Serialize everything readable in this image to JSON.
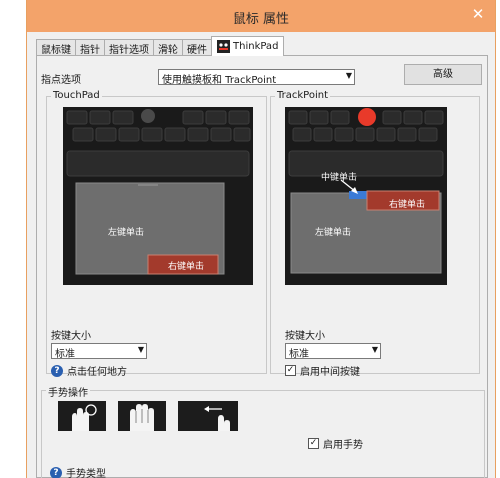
{
  "window": {
    "title": "鼠标 属性",
    "close": "✕"
  },
  "tabs": [
    {
      "label": "鼠标键"
    },
    {
      "label": "指针"
    },
    {
      "label": "指针选项"
    },
    {
      "label": "滑轮"
    },
    {
      "label": "硬件"
    },
    {
      "label": "ThinkPad",
      "active": true
    }
  ],
  "pointer": {
    "label": "指点选项",
    "select_value": "使用触摸板和 TrackPoint",
    "advanced_button": "高级"
  },
  "touchpad": {
    "title": "TouchPad",
    "image_labels": {
      "left_click": "左键单击",
      "right_click": "右键单击"
    },
    "size_label": "按键大小",
    "size_value": "标准",
    "help_text": "点击任何地方"
  },
  "trackpoint": {
    "title": "TrackPoint",
    "image_labels": {
      "middle_click": "中键单击",
      "left_click": "左键单击",
      "right_click": "右键单击"
    },
    "size_label": "按键大小",
    "size_value": "标准",
    "middle_button_label": "启用中间按键",
    "middle_button_checked": true
  },
  "gestures": {
    "title": "手势操作",
    "enable_label": "启用手势",
    "enable_checked": true,
    "help_text": "手势类型"
  },
  "colors": {
    "titlebar": "#f3a36a",
    "highlight": "#a33a2c",
    "trackpoint_nub": "#e83a2a",
    "help_icon": "#2a5fb0"
  }
}
